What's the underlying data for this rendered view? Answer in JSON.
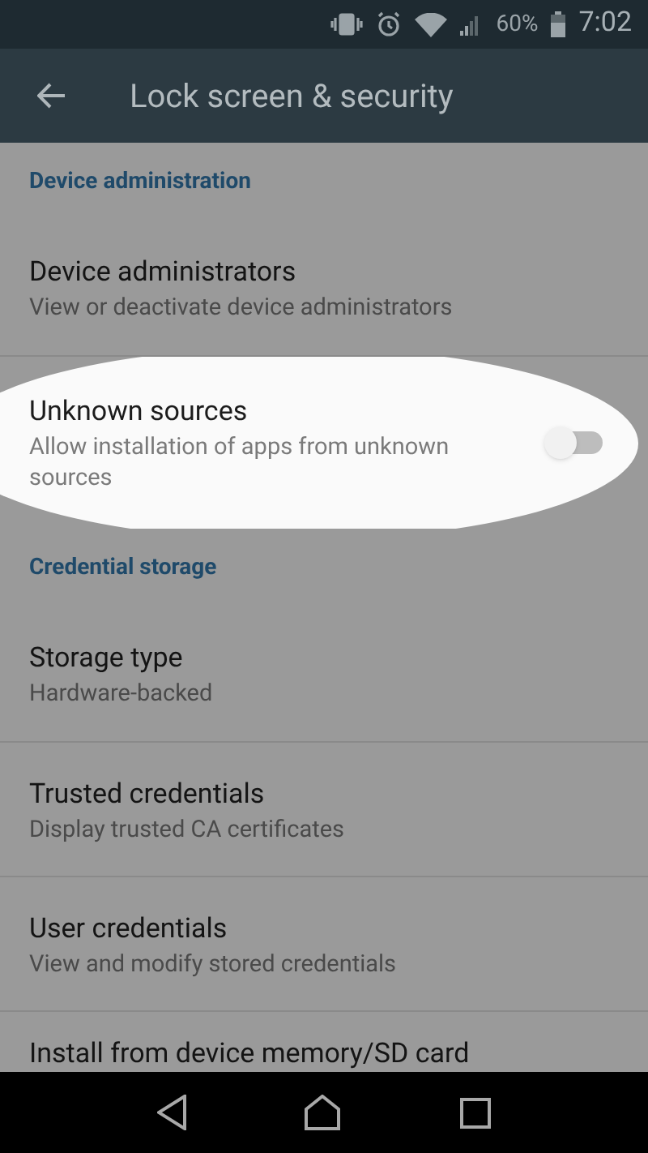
{
  "status_bar": {
    "battery": "60%",
    "time": "7:02"
  },
  "app_bar": {
    "title": "Lock screen & security"
  },
  "list": [
    {
      "kind": "header",
      "title": "Device administration"
    },
    {
      "kind": "item",
      "title": "Device administrators",
      "subtitle": "View or deactivate device administrators",
      "highlighted": false
    },
    {
      "kind": "toggle",
      "title": "Unknown sources",
      "subtitle": "Allow installation of apps from unknown sources",
      "on": false,
      "highlighted": true
    },
    {
      "kind": "header",
      "title": "Credential storage"
    },
    {
      "kind": "item",
      "title": "Storage type",
      "subtitle": "Hardware-backed",
      "highlighted": false
    },
    {
      "kind": "item",
      "title": "Trusted credentials",
      "subtitle": "Display trusted CA certificates",
      "highlighted": false
    },
    {
      "kind": "item",
      "title": "User credentials",
      "subtitle": "View and modify stored credentials",
      "highlighted": false
    },
    {
      "kind": "item",
      "title": "Install from device memory/SD card",
      "highlighted": false
    }
  ]
}
